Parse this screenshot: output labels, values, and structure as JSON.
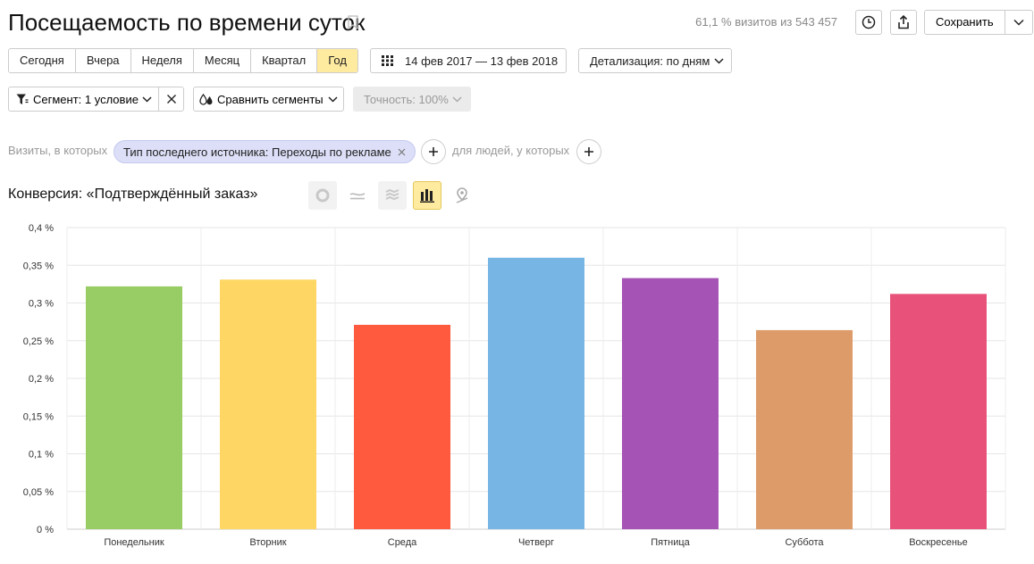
{
  "header": {
    "title": "Посещаемость по времени суток",
    "stats": "61,1 % визитов из 543 457",
    "save_label": "Сохранить"
  },
  "periods": [
    {
      "label": "Сегодня",
      "active": false
    },
    {
      "label": "Вчера",
      "active": false
    },
    {
      "label": "Неделя",
      "active": false
    },
    {
      "label": "Месяц",
      "active": false
    },
    {
      "label": "Квартал",
      "active": false
    },
    {
      "label": "Год",
      "active": true
    }
  ],
  "date_range": "14 фев 2017 — 13 фев 2018",
  "detail": "Детализация: по дням",
  "segment": {
    "label": "Сегмент: 1 условие",
    "compare_label": "Сравнить сегменты",
    "accuracy_label": "Точность: 100%"
  },
  "filter": {
    "prefix": "Визиты, в которых",
    "chip": "Тип последнего источника: Переходы по рекламе",
    "people": "для людей, у которых"
  },
  "chart_title": "Конверсия: «Подтверждённый заказ»",
  "chart_type_icons": [
    "pie-chart-icon",
    "line-chart-icon",
    "area-chart-icon",
    "bar-chart-icon",
    "map-icon"
  ],
  "chart_data": {
    "type": "bar",
    "categories": [
      "Понедельник",
      "Вторник",
      "Среда",
      "Четверг",
      "Пятница",
      "Суббота",
      "Воскресенье"
    ],
    "values": [
      0.322,
      0.331,
      0.271,
      0.36,
      0.333,
      0.264,
      0.312
    ],
    "colors": [
      "#98cc64",
      "#fdd663",
      "#ff5a3d",
      "#77b5e4",
      "#a653b6",
      "#dd9b69",
      "#e8517a"
    ],
    "yticks": [
      "0 %",
      "0,05 %",
      "0,1 %",
      "0,15 %",
      "0,2 %",
      "0,25 %",
      "0,3 %",
      "0,35 %",
      "0,4 %"
    ],
    "ylim": [
      0,
      0.4
    ],
    "grid": true
  }
}
